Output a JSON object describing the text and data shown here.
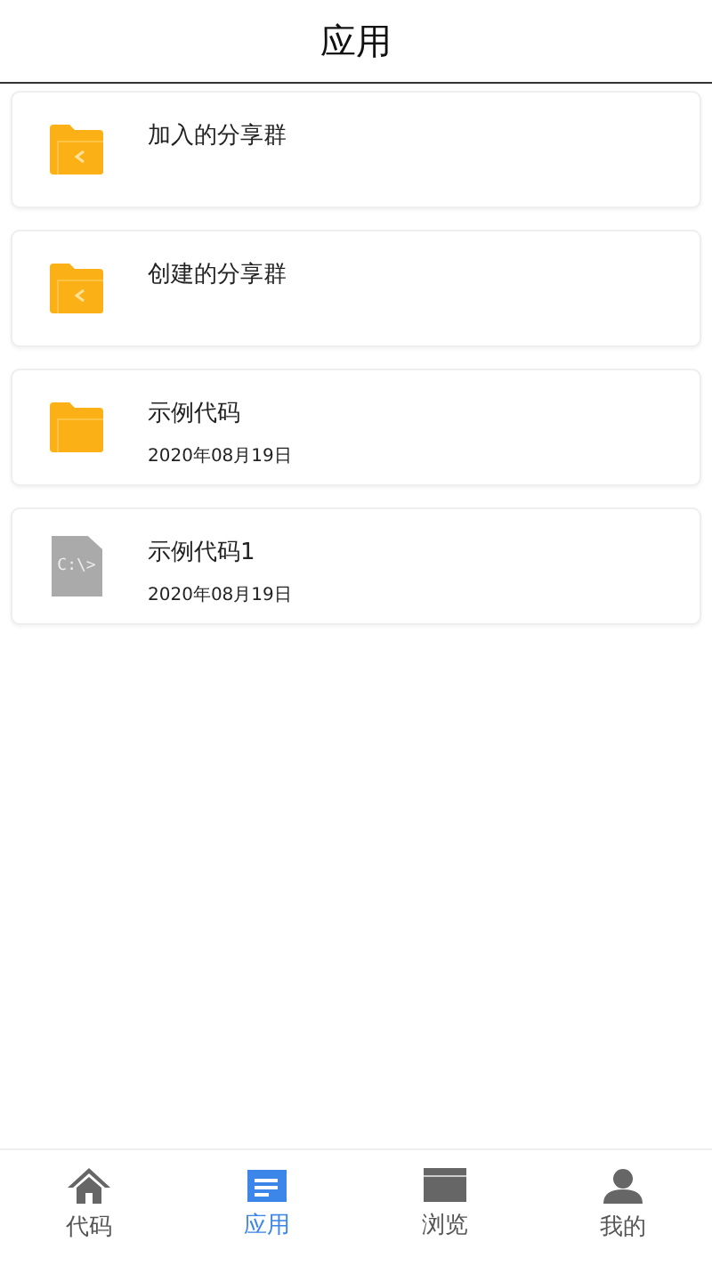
{
  "header": {
    "title": "应用"
  },
  "items": [
    {
      "kind": "shared_folder",
      "name": "加入的分享群"
    },
    {
      "kind": "shared_folder",
      "name": "创建的分享群"
    },
    {
      "kind": "folder",
      "name": "示例代码",
      "date": "2020年08月19日"
    },
    {
      "kind": "file",
      "name": "示例代码1",
      "date": "2020年08月19日",
      "icon_text": "C:\\>"
    }
  ],
  "nav": [
    {
      "kind": "home",
      "label": "代码",
      "selected": false
    },
    {
      "kind": "apps",
      "label": "应用",
      "selected": true
    },
    {
      "kind": "browser",
      "label": "浏览",
      "selected": false
    },
    {
      "kind": "user",
      "label": "我的",
      "selected": false
    }
  ]
}
